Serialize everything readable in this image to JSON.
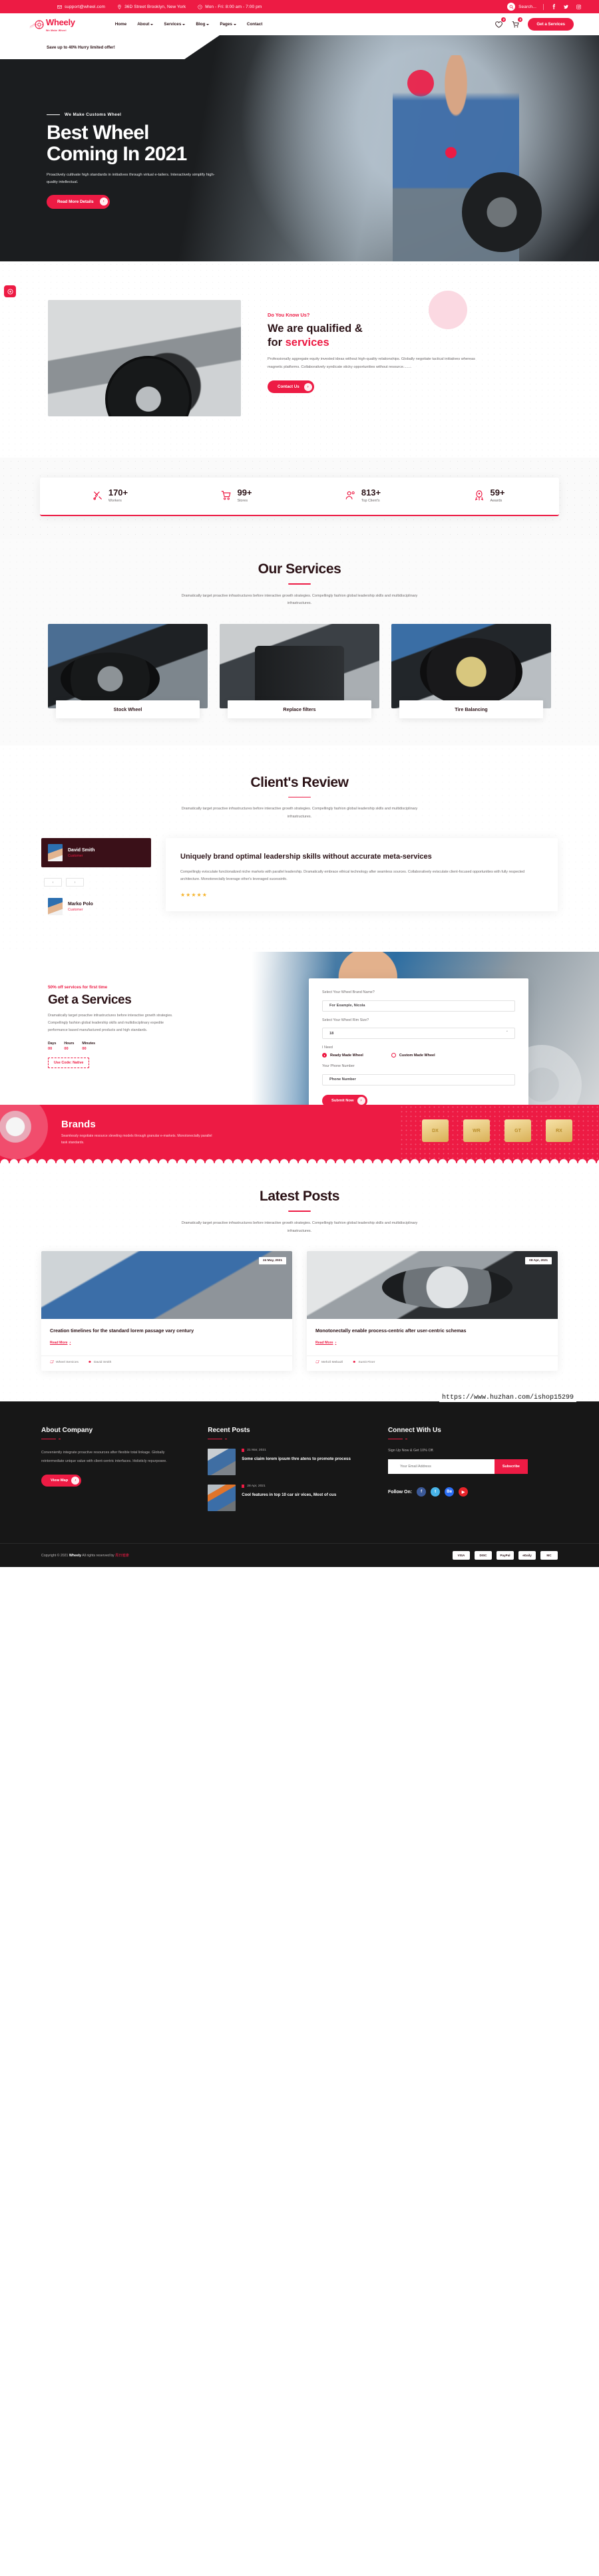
{
  "topbar": {
    "email": "support@wheel.com",
    "address": "36D Street Brooklyn, New York",
    "hours": "Mon - Fri: 8:00 am - 7:00 pm",
    "search_label": "Search...",
    "socials": [
      "f",
      "t",
      "i"
    ]
  },
  "nav": {
    "brand": "Wheely",
    "tagline": "We Make Wheel",
    "menu": [
      "Home",
      "About",
      "Services",
      "Blog",
      "Pages",
      "Contact"
    ],
    "wishlist_count": "0",
    "cart_count": "0",
    "cta": "Get a Services"
  },
  "hero": {
    "ribbon": "Save up to 40% Hurry limited offer!",
    "eyebrow": "We Make Customs Wheel",
    "title_line1": "Best Wheel",
    "title_line2": "Coming In 2021",
    "paragraph": "Proactively cultivate high standards in initiatives through virtual e-tailers. Interactively simplify high-quality intellectual.",
    "button": "Read More Details"
  },
  "about": {
    "kicker": "Do You Know Us?",
    "title_line1": "We are qualified &",
    "title_line2_pre": "for ",
    "title_line2_accent": "services",
    "paragraph": "Professionally aggregate equity invested ideas without high-quality relationships. Globally negotiate tactical initiatives whereas magnetic platforms. Collaboratively syndicate sticky opportunities without resource........",
    "button": "Contact Us"
  },
  "stats": [
    {
      "icon": "tools-icon",
      "value": "170+",
      "label": "Workers"
    },
    {
      "icon": "cart-icon",
      "value": "99+",
      "label": "Stores"
    },
    {
      "icon": "users-icon",
      "value": "813+",
      "label": "Top Client's"
    },
    {
      "icon": "award-icon",
      "value": "59+",
      "label": "Awards"
    }
  ],
  "services": {
    "title": "Our Services",
    "subtitle": "Dramatically target proactive infrastructures before interactive growth strategies. Compellingly fashion global leadership skills and multidisciplinary infrastructures.",
    "cards": [
      {
        "label": "Stock Wheel"
      },
      {
        "label": "Replace filters"
      },
      {
        "label": "Tire Balancing"
      }
    ]
  },
  "review": {
    "title": "Client's Review",
    "subtitle": "Dramatically target proactive infrastructures before interactive growth strategies. Compellingly fashion global leadership skills and multidisciplinary infrastructures.",
    "people": [
      {
        "name": "David Smith",
        "role": "Customer"
      },
      {
        "name": "Marko Polo",
        "role": "Customer"
      }
    ],
    "prev": "‹",
    "next": "›",
    "quote_title": "Uniquely brand optimal leadership skills without accurate meta-services",
    "quote_body": "Compellingly evisculate functionalized niche markets with parallel leadership. Dramatically embrace ethical technology after seamless sources. Collaboratively evisculate client-focused opportunities with fully respected architecture. Monotonectally leverage other's leveraged sucessinfo.",
    "stars": "★★★★★"
  },
  "getservice": {
    "kicker": "50% off services for first time",
    "title": "Get a Services",
    "paragraph": "Dramatically target proactive infrastructures before interactive growth strategies. Compellingly fashion global leadership skills and multidisciplinary expedite performance based manufactured products and high standards.",
    "counters": [
      {
        "label": "Days",
        "value": "00"
      },
      {
        "label": "Hours",
        "value": "00"
      },
      {
        "label": "Minutes",
        "value": "00"
      }
    ],
    "code": "Use Code: Native",
    "form": {
      "brand_label": "Select Your Wheel Brand Name?",
      "brand_placeholder": "For Example, Nicola",
      "rim_label": "Select Your Wheel Rim Size?",
      "rim_value": "18",
      "need_label": "I Need",
      "option_ready": "Ready Made Wheel",
      "option_custom": "Custom Made Wheel",
      "phone_label": "Your Phone Number",
      "phone_placeholder": "Phone Number",
      "submit": "Submit Now"
    }
  },
  "brands": {
    "title": "Brands",
    "paragraph": "Seamlessly negotiate resource sleveling models through granular e-markets. Monotonectally parallel task standards.",
    "logos": [
      "DX",
      "WR",
      "GT",
      "RX"
    ]
  },
  "posts": {
    "title": "Latest Posts",
    "subtitle": "Dramatically target proactive infrastructures before interactive growth strategies. Compellingly fashion global leadership skills and multidisciplinary infrastructures.",
    "items": [
      {
        "date": "24 May, 2021",
        "title": "Creation timelines for the standard lorem passage vary century",
        "read_more": "Read More",
        "category": "Wheel Services",
        "author": "David Smith"
      },
      {
        "date": "08 Apr, 2021",
        "title": "Monotonectally enable process-centric after user-centric schemas",
        "read_more": "Read More",
        "category": "Mehzil Mebazil",
        "author": "Sumit Finer"
      }
    ]
  },
  "footer": {
    "about": {
      "heading": "About Company",
      "text": "Conveniently integrate proactive resources after flexible total linkage. Globally reintermediate unique value with client-centric interfaces. Holisticly repurposee.",
      "button": "View Map"
    },
    "recent": {
      "heading": "Recent Posts",
      "items": [
        {
          "date": "21 Mar, 2021",
          "title": "Some claim lorem ipsum thre atens to promote process"
        },
        {
          "date": "28 Apr, 2021",
          "title": "Cool features in top 10 car sir vices, Most of cus"
        }
      ]
    },
    "connect": {
      "heading": "Connect With Us",
      "subtitle": "Sign Up Now & Get 10% Off.",
      "email_placeholder": "Your Email Address",
      "subscribe": "Subscribe",
      "follow_label": "Follow On:",
      "socials": [
        "f",
        "t",
        "Bʙ",
        "▶"
      ]
    },
    "copyright_pre": "Copyright © 2021 ",
    "copyright_brand": "Wheely",
    "copyright_mid": " All rights reserved by ",
    "copyright_author": "周日健康",
    "payments": [
      "VISA",
      "DISC",
      "PayPal",
      "eDaily",
      "MC"
    ]
  },
  "watermark": "https://www.huzhan.com/ishop15299",
  "colors": {
    "brand": "#ed1b44",
    "dark": "#2b1216",
    "footer": "#171717"
  }
}
